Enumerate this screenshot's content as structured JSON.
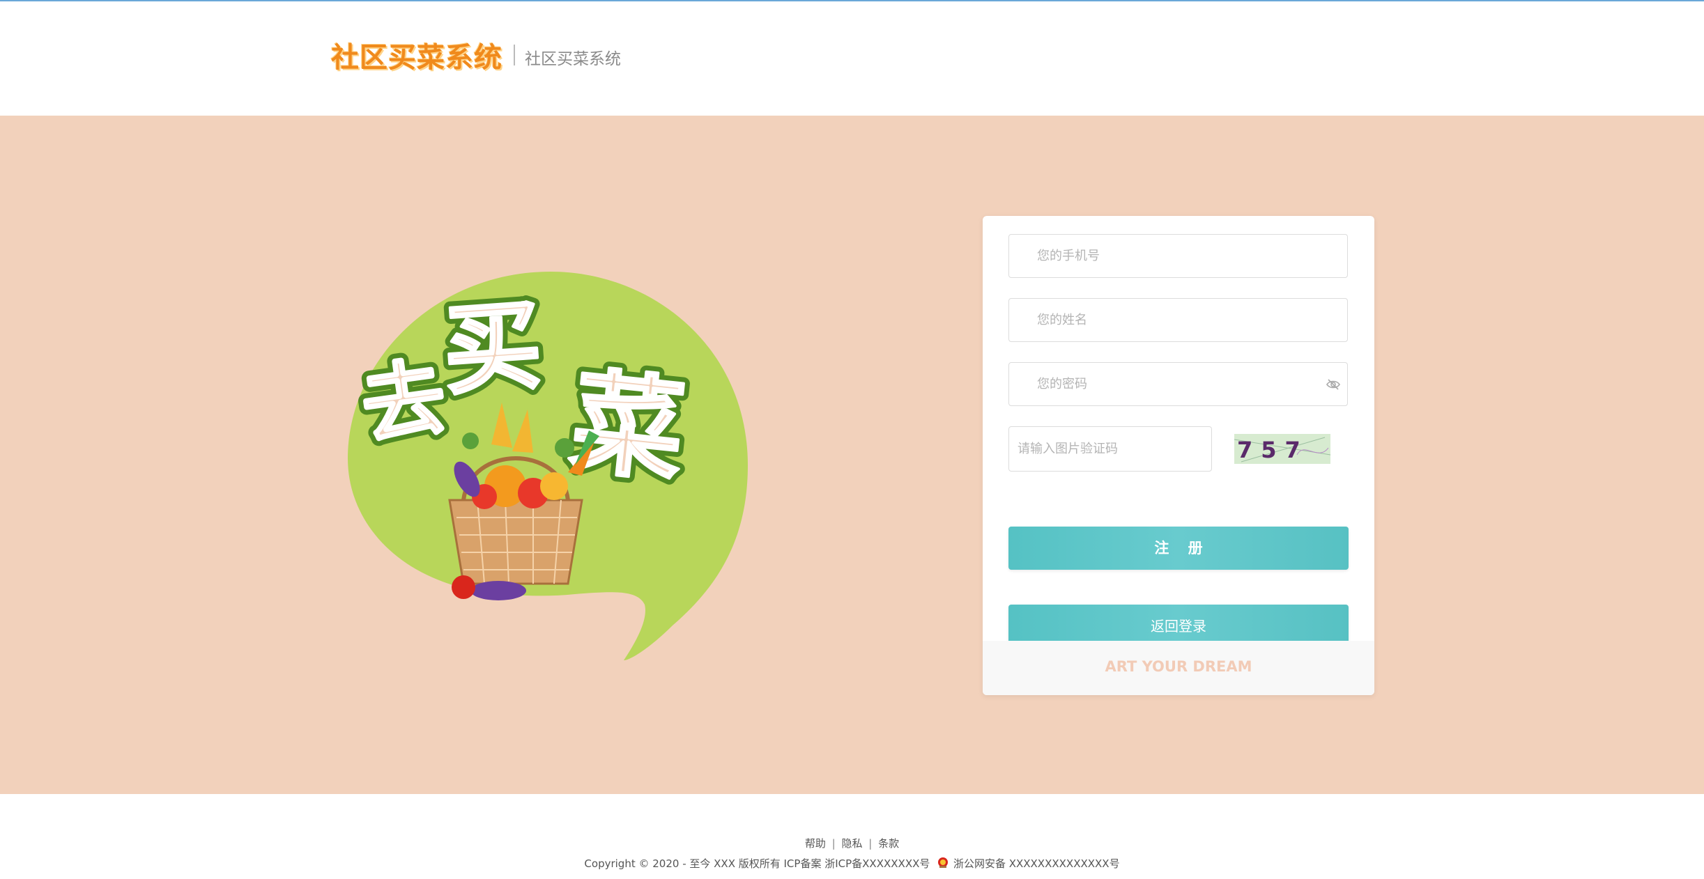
{
  "header": {
    "brand_logo_text": "社区买菜系统",
    "brand_subtitle": "社区买菜系统"
  },
  "hero": {
    "logo_text": "去买菜"
  },
  "form": {
    "phone_placeholder": "您的手机号",
    "name_placeholder": "您的姓名",
    "password_placeholder": "您的密码",
    "captcha_placeholder": "请输入图片验证码",
    "captcha_code": "757",
    "register_label": "注 册",
    "back_login_label": "返回登录",
    "slogan": "ART YOUR DREAM"
  },
  "footer": {
    "links": [
      "帮助",
      "隐私",
      "条款"
    ],
    "separator": "|",
    "copyright": "Copyright © 2020 - 至今 XXX 版权所有 ICP备案 浙ICP备XXXXXXXX号",
    "police_record": "浙公网安备 XXXXXXXXXXXXXX号"
  },
  "colors": {
    "accent_teal": "#5cc4c6",
    "brand_orange": "#f08a1c",
    "background_peach": "#f2d1bb",
    "hero_green": "#b8d65a"
  }
}
